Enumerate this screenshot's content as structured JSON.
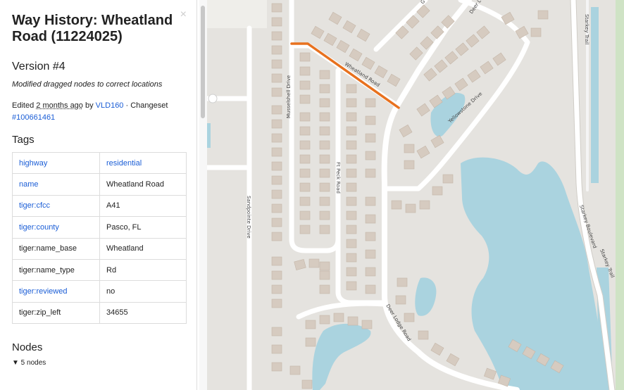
{
  "sidebar": {
    "close_glyph": "×",
    "title": "Way History: Wheatland Road (11224025)",
    "version": "Version #4",
    "comment": "Modified dragged nodes to correct locations",
    "edited_prefix": "Edited",
    "edited_ago": "2 months ago",
    "edited_by": "by",
    "user": "VLD160",
    "changeset_label": "· Changeset",
    "changeset": "#100661461",
    "tags_heading": "Tags",
    "tags": [
      {
        "key": "highway",
        "value": "residential"
      },
      {
        "key": "name",
        "value": "Wheatland Road"
      },
      {
        "key": "tiger:cfcc",
        "value": "A41"
      },
      {
        "key": "tiger:county",
        "value": "Pasco, FL"
      },
      {
        "key": "tiger:name_base",
        "value": "Wheatland"
      },
      {
        "key": "tiger:name_type",
        "value": "Rd"
      },
      {
        "key": "tiger:reviewed",
        "value": "no"
      },
      {
        "key": "tiger:zip_left",
        "value": "34655"
      }
    ],
    "nodes_heading": "Nodes",
    "nodes_toggle": "▼ 5 nodes"
  },
  "map": {
    "road_labels": {
      "wheatland": "Wheatland Road",
      "musselshell": "Musselshell Drive",
      "ftpeck": "Ft Peck Road",
      "sandpointe": "Sandpointe Drive",
      "yellowstone": "Yellowstone Drive",
      "deerlodge": "Deer Lodge Road",
      "starkey_blvd": "Starkey Boulevard",
      "starkey_trail": "Starkey Trail",
      "deer_top": "Deer L",
      "g_top": "G"
    },
    "colors": {
      "land": "#e5e3df",
      "water": "#aad3df",
      "building": "#d6cbc0",
      "highlight": "#e8711e",
      "link": "#1a5dd6"
    }
  }
}
